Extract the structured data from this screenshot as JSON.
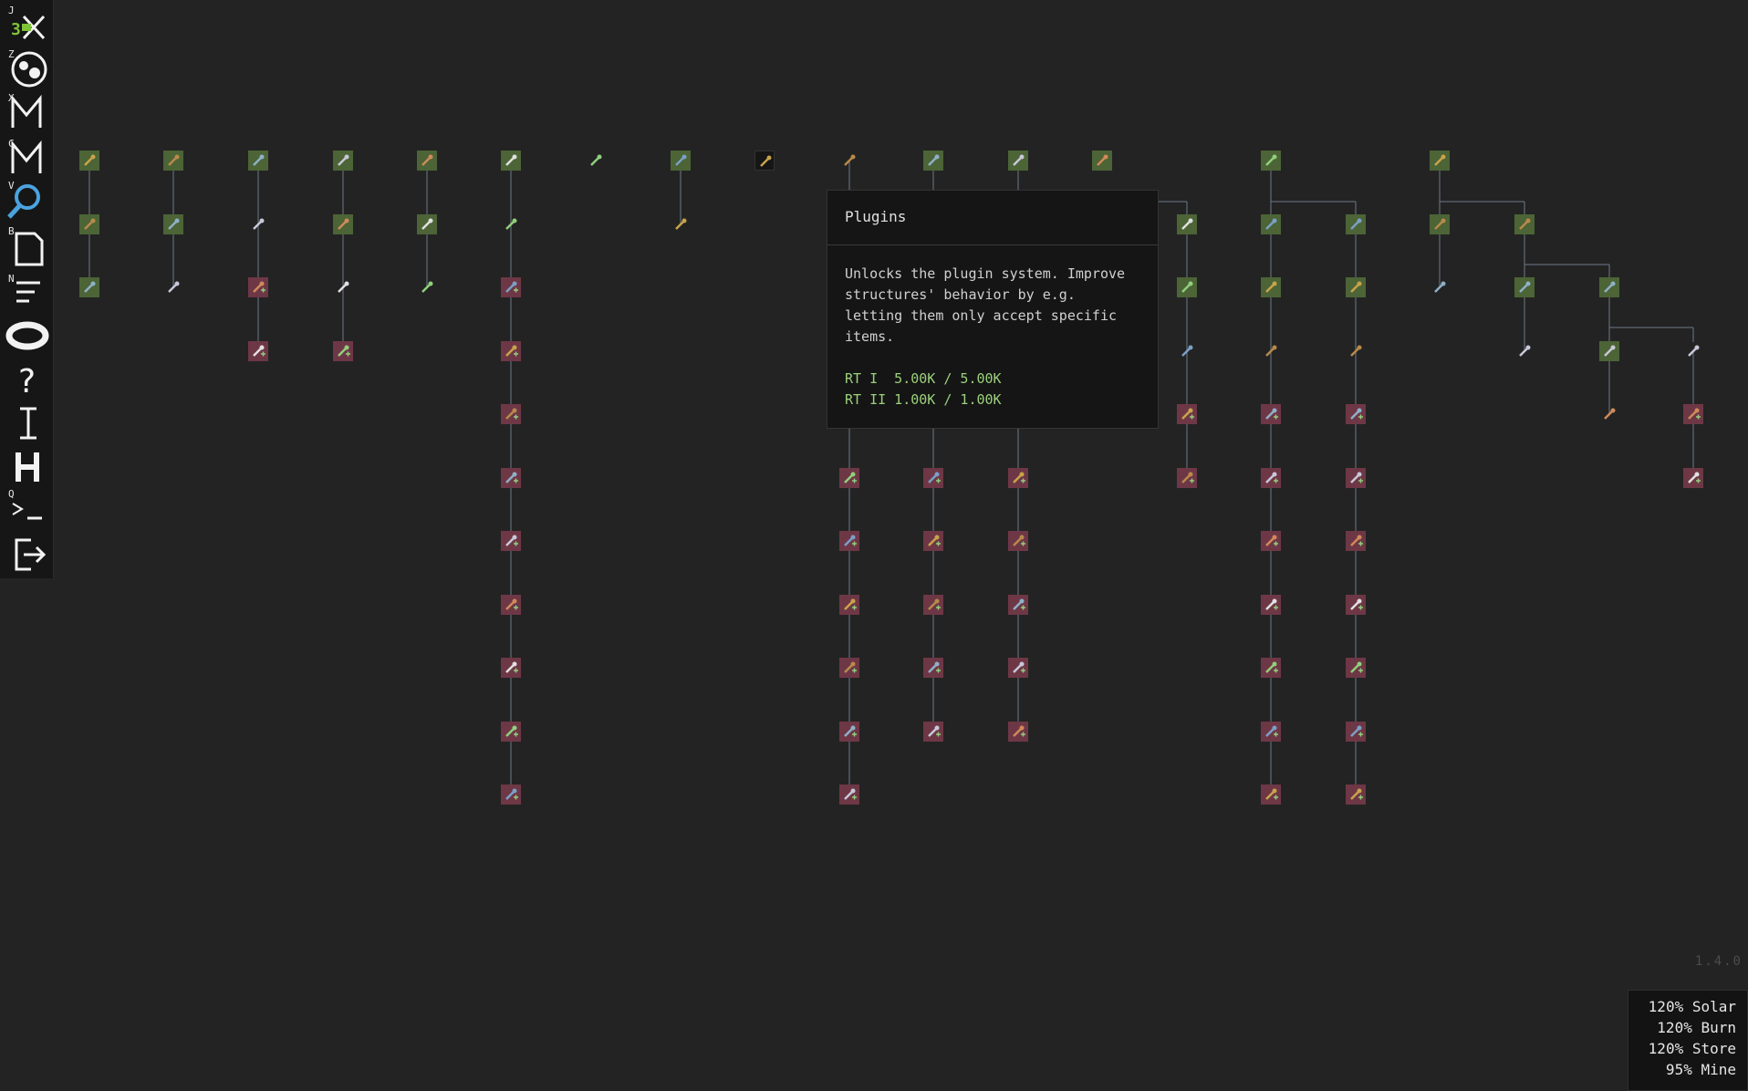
{
  "toolbar": {
    "buttons": [
      {
        "id": "jsx",
        "hotkey": "J"
      },
      {
        "id": "planet",
        "hotkey": "Z"
      },
      {
        "id": "map-x",
        "hotkey": "X"
      },
      {
        "id": "map-c",
        "hotkey": "C"
      },
      {
        "id": "search",
        "hotkey": "V"
      },
      {
        "id": "blueprint",
        "hotkey": "B"
      },
      {
        "id": "filter",
        "hotkey": "N"
      },
      {
        "id": "ring",
        "hotkey": ""
      },
      {
        "id": "help",
        "hotkey": ""
      },
      {
        "id": "info",
        "hotkey": ""
      },
      {
        "id": "hub",
        "hotkey": ""
      },
      {
        "id": "console",
        "hotkey": "Q"
      },
      {
        "id": "exit",
        "hotkey": ""
      }
    ]
  },
  "colors": {
    "background": "#232323",
    "unlocked": "#4c6436",
    "locked": "#6e3746",
    "line": "#6c7a88",
    "accent_blue": "#4aa3df",
    "cost_text": "#9bd07c"
  },
  "tech_tree": {
    "columns": [
      {
        "icon": "hammer-icon",
        "states": [
          "green",
          "green",
          "green"
        ]
      },
      {
        "icon": "wrench-icon",
        "states": [
          "green",
          "green",
          "bare"
        ]
      },
      {
        "icon": "crate-icon",
        "states": [
          "green",
          "bare",
          "red",
          "red"
        ]
      },
      {
        "icon": "drill-icon",
        "states": [
          "green",
          "green",
          "bare",
          "red"
        ]
      },
      {
        "icon": "pipe-icon",
        "states": [
          "green",
          "green",
          "bare"
        ]
      },
      {
        "icon": "tube-icon",
        "states": [
          "green",
          "bare",
          "red",
          "red",
          "red",
          "red",
          "red",
          "red",
          "red",
          "red",
          "red"
        ]
      },
      {
        "icon": "g-rune-icon",
        "states": [
          "bare"
        ]
      },
      {
        "icon": "cable-icon",
        "states": [
          "green",
          "bare"
        ]
      },
      {
        "icon": "mountain-icon",
        "states": [
          "dark"
        ]
      },
      {
        "icon": "plugin-icon",
        "states": [
          "bare",
          "hidden",
          "hidden",
          "hidden",
          "hidden",
          "red",
          "red",
          "red",
          "red",
          "red",
          "red"
        ]
      },
      {
        "icon": "board-icon",
        "states": [
          "green",
          "hidden",
          "hidden",
          "hidden",
          "hidden",
          "red",
          "red",
          "red",
          "red",
          "red"
        ]
      },
      {
        "icon": "cog-icon",
        "states": [
          "green",
          "hidden",
          "hidden",
          "hidden",
          "hidden",
          "red",
          "red",
          "red",
          "red",
          "red"
        ]
      },
      {
        "icon": "storage-icon",
        "states": [
          "green"
        ]
      },
      {
        "icon": "chest-icon",
        "states": [
          "green",
          "green",
          "bare",
          "red",
          "red"
        ]
      },
      {
        "icon": "gem-icon",
        "states": [
          "green",
          "green",
          "green",
          "bare",
          "red",
          "red",
          "red",
          "red",
          "red",
          "red",
          "red"
        ]
      },
      {
        "icon": "bucket-icon",
        "states": [
          "green",
          "green",
          "bare",
          "red",
          "red",
          "red",
          "red",
          "red",
          "red",
          "red"
        ]
      },
      {
        "icon": "axe-icon",
        "states": [
          "green",
          "green",
          "bare"
        ]
      },
      {
        "icon": "bush-icon",
        "states": [
          "green",
          "green",
          "bare"
        ]
      },
      {
        "icon": "leaf-icon",
        "states": [
          "green",
          "green",
          "bare"
        ]
      },
      {
        "icon": "fish-icon",
        "states": [
          "bare",
          "red",
          "red"
        ]
      }
    ]
  },
  "tooltip": {
    "title": "Plugins",
    "description": "Unlocks the plugin system. Improve structures' behavior by e.g. letting them only accept specific items.",
    "costs": [
      "RT I  5.00K / 5.00K",
      "RT II 1.00K / 1.00K"
    ]
  },
  "version": "1.4.0",
  "modifiers": [
    "120% Solar",
    "120% Burn",
    "120% Store",
    " 95% Mine"
  ]
}
